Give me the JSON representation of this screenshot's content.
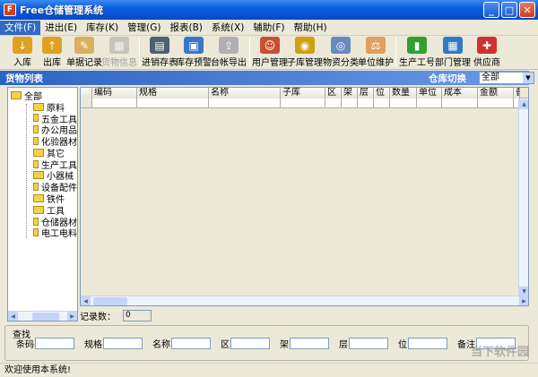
{
  "window": {
    "title": "Free仓储管理系统",
    "min": "_",
    "max": "□",
    "close": "✕"
  },
  "menu": [
    "文件(F)",
    "进出(E)",
    "库存(K)",
    "管理(G)",
    "报表(B)",
    "系统(X)",
    "辅助(F)",
    "帮助(H)"
  ],
  "toolbar": [
    {
      "label": "入库",
      "icon": "inbound-icon",
      "color": "#e0a020"
    },
    {
      "label": "出库",
      "icon": "outbound-icon",
      "color": "#e0a020"
    },
    {
      "label": "单据记录",
      "icon": "record-icon",
      "color": "#d8b060"
    },
    {
      "label": "货物信息",
      "icon": "goods-icon",
      "color": "#9a9a9a",
      "disabled": true
    },
    {
      "label": "进销存表",
      "icon": "chart-icon",
      "color": "#506070"
    },
    {
      "label": "库存预警",
      "icon": "monitor-icon",
      "color": "#3878c8"
    },
    {
      "label": "台帐导出",
      "icon": "export-icon",
      "color": "#b0b0b0"
    },
    {
      "label": "用户管理",
      "icon": "user-icon",
      "color": "#c85030"
    },
    {
      "label": "子库管理",
      "icon": "storage-icon",
      "color": "#d0a010"
    },
    {
      "label": "物资分类",
      "icon": "category-icon",
      "color": "#6888c0"
    },
    {
      "label": "单位维护",
      "icon": "unit-icon",
      "color": "#e0a060"
    },
    {
      "label": "生产工号",
      "icon": "worker-icon",
      "color": "#30a030"
    },
    {
      "label": "部门管理",
      "icon": "department-icon",
      "color": "#3078c8"
    },
    {
      "label": "供应商",
      "icon": "supplier-icon",
      "color": "#d03030"
    }
  ],
  "panel": {
    "title": "货物列表",
    "switch_label": "仓库切换",
    "warehouse": "全部"
  },
  "tree": {
    "root": "全部",
    "items": [
      "原料",
      "五金工具",
      "办公用品",
      "化验器材",
      "其它",
      "生产工具",
      "小器械",
      "设备配件",
      "铁件",
      "工具",
      "仓储器材",
      "电工电料"
    ]
  },
  "grid": {
    "columns": [
      "",
      "编码",
      "规格",
      "名称",
      "子库",
      "区",
      "架",
      "层",
      "位",
      "数量",
      "单位",
      "成本",
      "金额",
      "备"
    ]
  },
  "record_count": {
    "label": "记录数：",
    "value": "0"
  },
  "search": {
    "title": "查找",
    "fields": [
      "条码",
      "规格",
      "名称",
      "区",
      "架",
      "层",
      "位",
      "备注"
    ]
  },
  "status": "欢迎使用本系统!",
  "watermark": "当下软件园"
}
